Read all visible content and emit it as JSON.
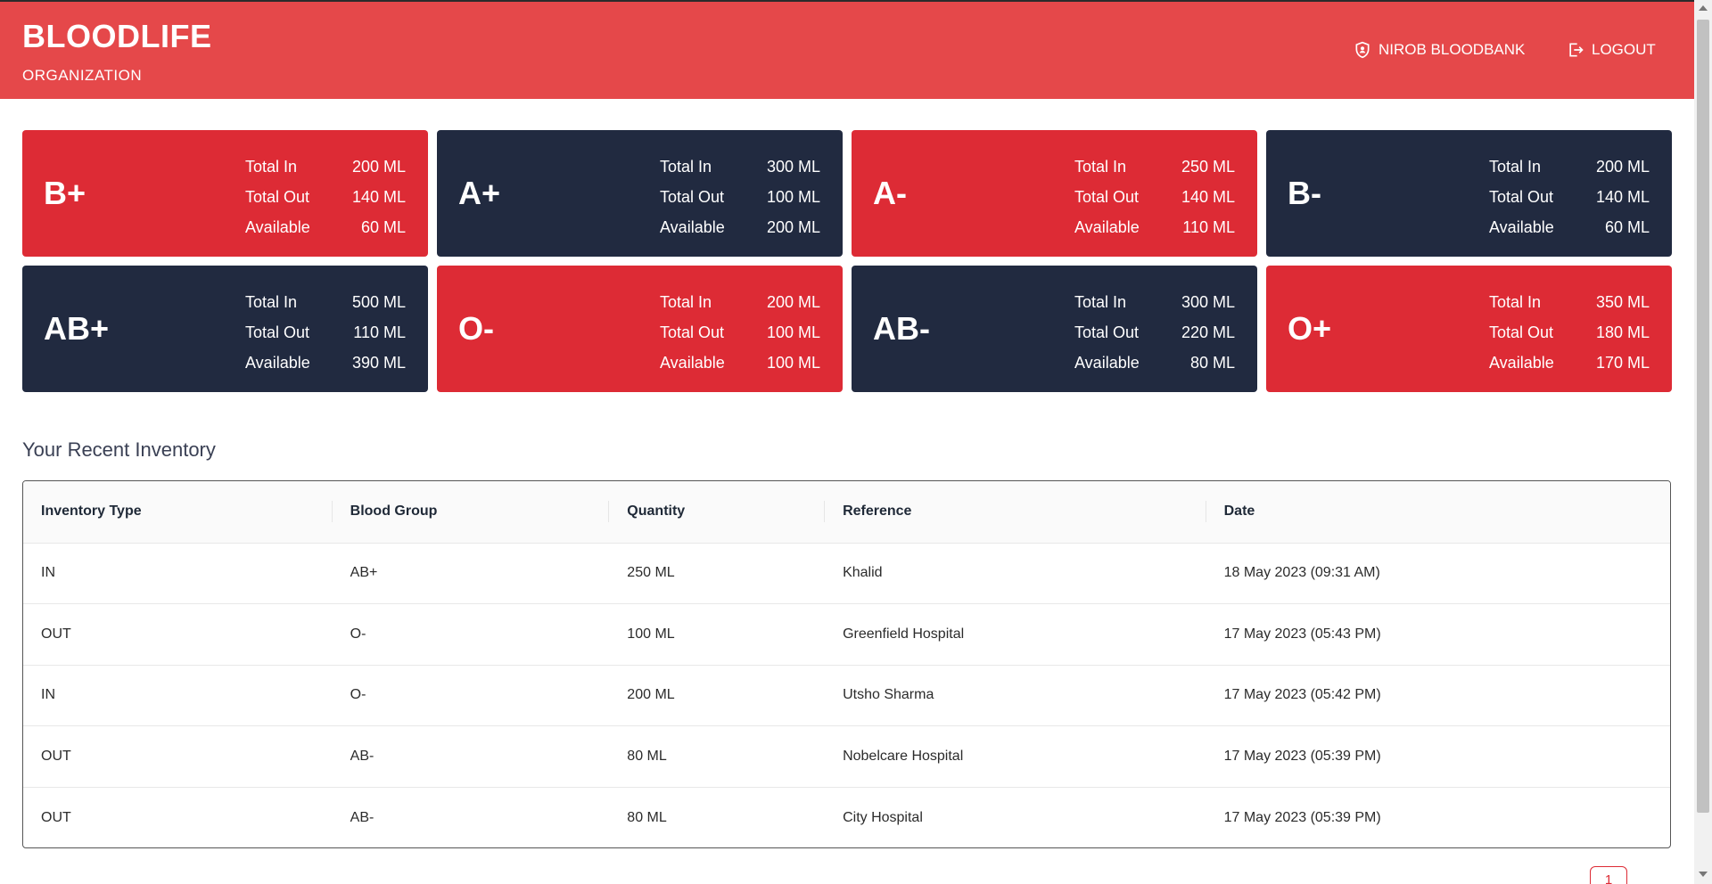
{
  "header": {
    "brand": "BLOODLIFE",
    "subtitle": "ORGANIZATION",
    "org_label": "NIROB BLOODBANK",
    "logout_label": "LOGOUT"
  },
  "labels": {
    "total_in": "Total In",
    "total_out": "Total Out",
    "available": "Available"
  },
  "cards": [
    {
      "group": "B+",
      "total_in": "200 ML",
      "total_out": "140 ML",
      "available": "60 ML",
      "color": "#dd2b35"
    },
    {
      "group": "A+",
      "total_in": "300 ML",
      "total_out": "100 ML",
      "available": "200 ML",
      "color": "#212a40"
    },
    {
      "group": "A-",
      "total_in": "250 ML",
      "total_out": "140 ML",
      "available": "110 ML",
      "color": "#dd2b35"
    },
    {
      "group": "B-",
      "total_in": "200 ML",
      "total_out": "140 ML",
      "available": "60 ML",
      "color": "#212a40"
    },
    {
      "group": "AB+",
      "total_in": "500 ML",
      "total_out": "110 ML",
      "available": "390 ML",
      "color": "#212a40"
    },
    {
      "group": "O-",
      "total_in": "200 ML",
      "total_out": "100 ML",
      "available": "100 ML",
      "color": "#dd2b35"
    },
    {
      "group": "AB-",
      "total_in": "300 ML",
      "total_out": "220 ML",
      "available": "80 ML",
      "color": "#212a40"
    },
    {
      "group": "O+",
      "total_in": "350 ML",
      "total_out": "180 ML",
      "available": "170 ML",
      "color": "#dd2b35"
    }
  ],
  "inventory": {
    "title": "Your Recent Inventory",
    "columns": [
      "Inventory Type",
      "Blood Group",
      "Quantity",
      "Reference",
      "Date"
    ],
    "rows": [
      [
        "IN",
        "AB+",
        "250 ML",
        "Khalid",
        "18 May 2023 (09:31 AM)"
      ],
      [
        "OUT",
        "O-",
        "100 ML",
        "Greenfield Hospital",
        "17 May 2023 (05:43 PM)"
      ],
      [
        "IN",
        "O-",
        "200 ML",
        "Utsho Sharma",
        "17 May 2023 (05:42 PM)"
      ],
      [
        "OUT",
        "AB-",
        "80 ML",
        "Nobelcare Hospital",
        "17 May 2023 (05:39 PM)"
      ],
      [
        "OUT",
        "AB-",
        "80 ML",
        "City Hospital",
        "17 May 2023 (05:39 PM)"
      ]
    ]
  },
  "pagination": {
    "current": "1"
  },
  "colors": {
    "header": "#e5484a",
    "red": "#dd2b35",
    "dark": "#212a40"
  }
}
